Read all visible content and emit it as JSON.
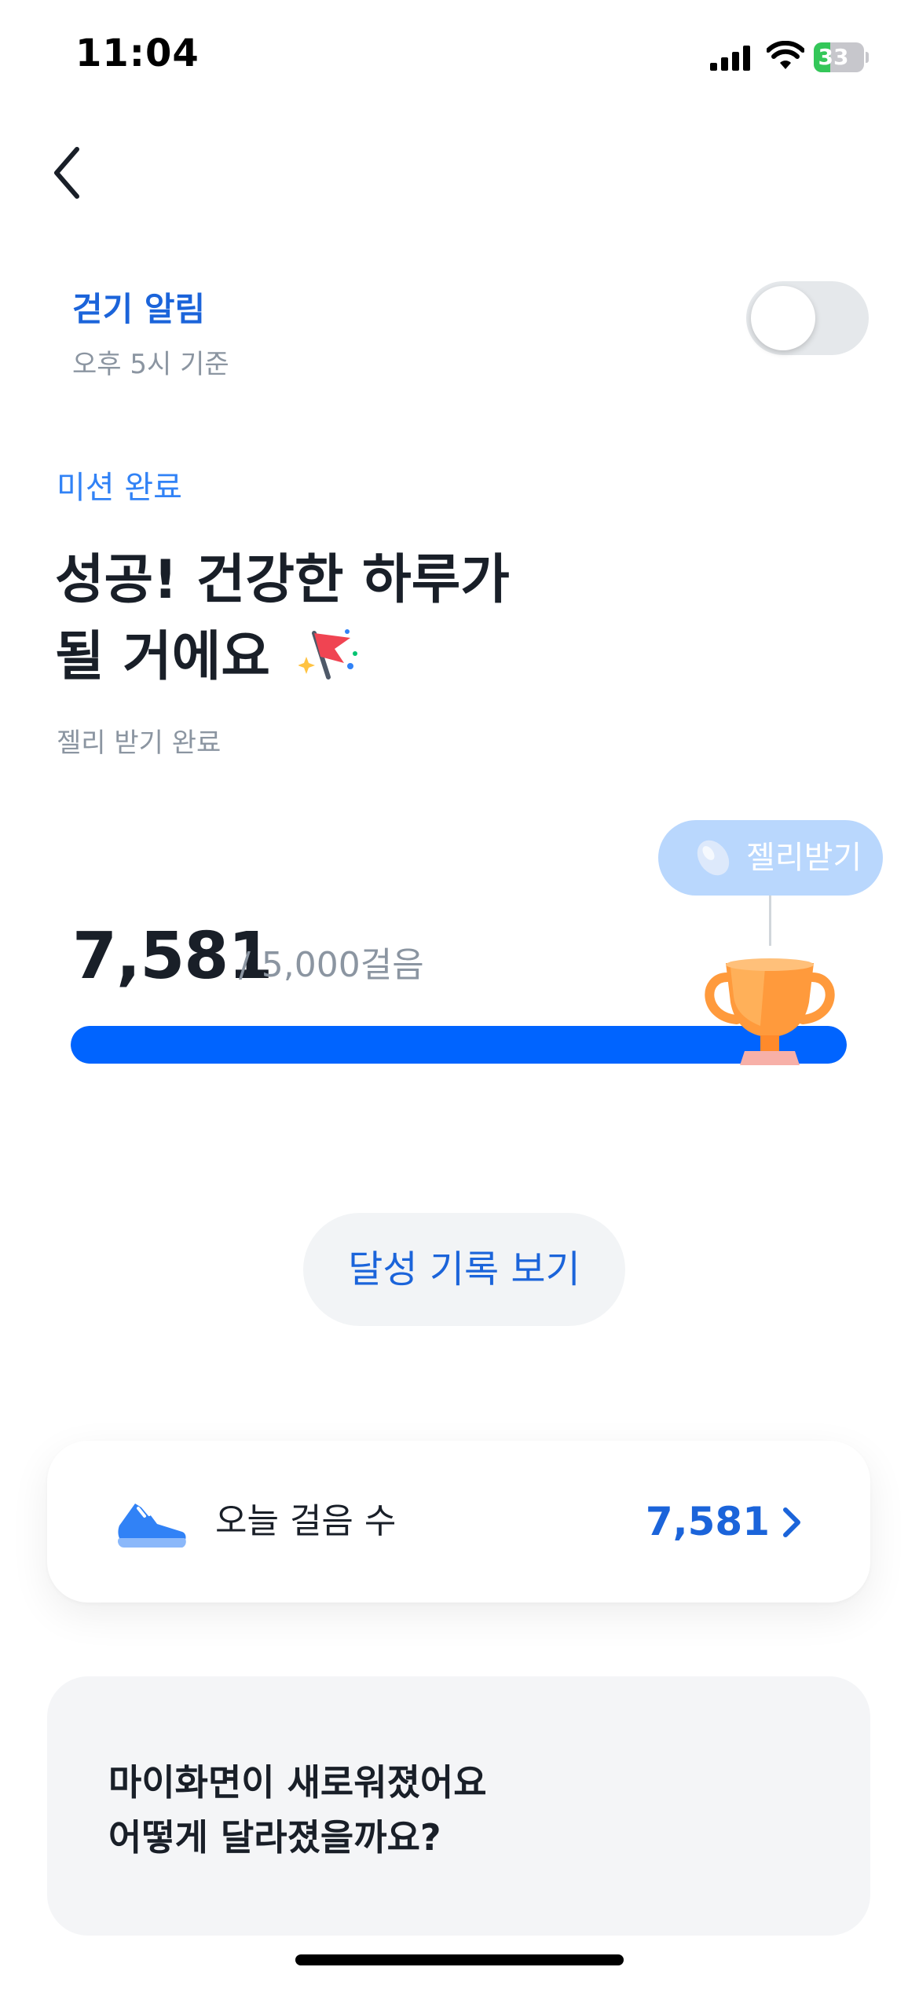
{
  "status_bar": {
    "time": "11:04",
    "battery_percent": "33",
    "battery_level": 0.33,
    "battery_color": "#34c759"
  },
  "nav": {
    "back_icon": "chevron-left-icon"
  },
  "walk_alarm": {
    "title": "걷기 알림",
    "subtitle": "오후 5시 기준",
    "enabled": false
  },
  "mission": {
    "label": "미션 완료",
    "headline_line1": "성공! 건강한 하루가",
    "headline_line2": "될 거에요",
    "headline_icon": "party-flag-icon",
    "jelly_status": "젤리 받기 완료"
  },
  "progress": {
    "current": "7,581",
    "goal_text": "/ 5,000걸음",
    "fill_fraction": 1.0,
    "bar_color": "#0064ff",
    "jelly_button_label": "젤리받기",
    "jelly_icon": "jelly-bean-icon",
    "trophy_icon": "trophy-icon"
  },
  "history_button": {
    "label": "달성 기록 보기"
  },
  "today_steps_card": {
    "icon": "sneaker-icon",
    "label": "오늘 걸음 수",
    "value": "7,581"
  },
  "notice_card": {
    "line1": "마이화면이 새로워졌어요",
    "line2": "어떻게 달라졌을까요?"
  },
  "colors": {
    "accent": "#3182f6",
    "accent_dark": "#1b64da",
    "text_primary": "#191f28",
    "text_secondary": "#8b95a1"
  }
}
